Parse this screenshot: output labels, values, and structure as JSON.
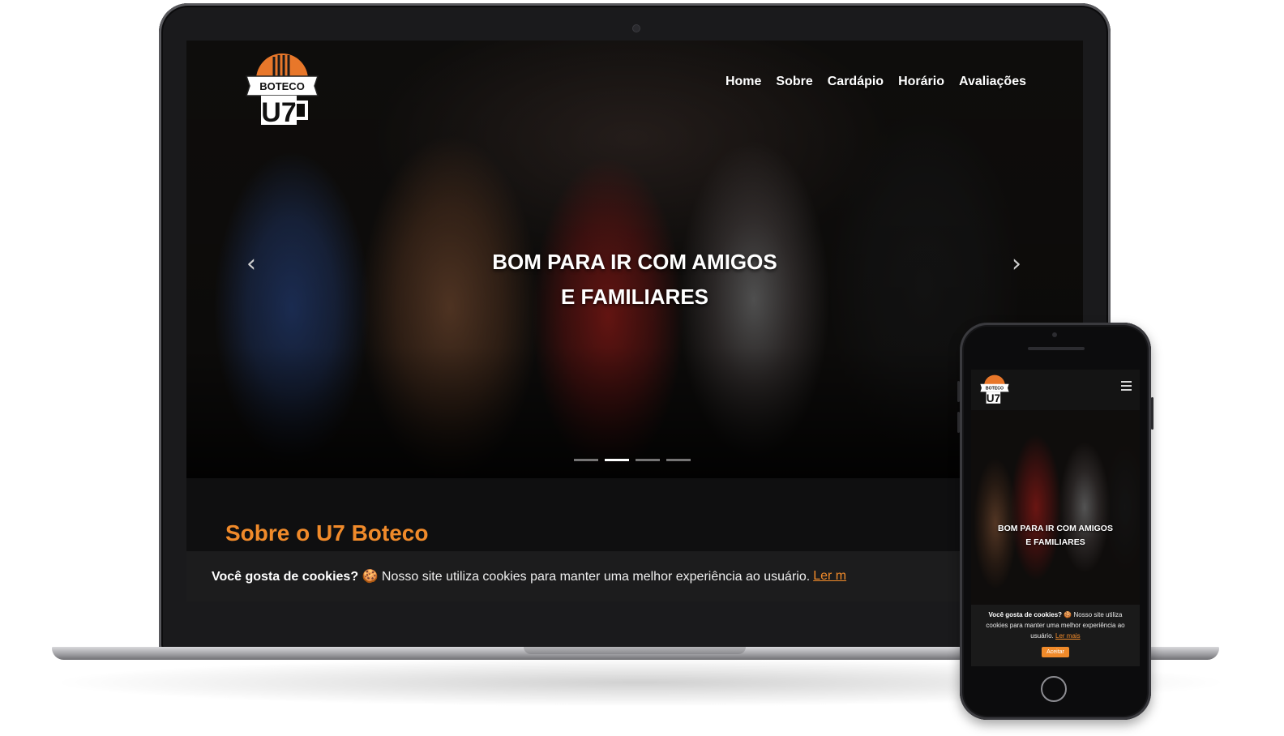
{
  "brand": {
    "logo_top": "BOTECO",
    "logo_main": "U7",
    "accent_color": "#f08a2a"
  },
  "desktop": {
    "nav": [
      {
        "label": "Home"
      },
      {
        "label": "Sobre"
      },
      {
        "label": "Cardápio"
      },
      {
        "label": "Horário"
      },
      {
        "label": "Avaliações"
      }
    ],
    "hero": {
      "title_line1": "BOM PARA IR COM AMIGOS",
      "title_line2": "E FAMILIARES",
      "prev_icon": "‹",
      "next_icon": "›",
      "slides": 4,
      "active_slide": 2
    },
    "about_title": "Sobre o U7 Boteco",
    "cookie": {
      "heading": "Você gosta de cookies?",
      "icon": "🍪",
      "text": "Nosso site utiliza cookies para manter uma melhor experiência ao usuário.",
      "link": "Ler m"
    }
  },
  "mobile": {
    "menu_icon": "hamburger-icon",
    "hero": {
      "title_line1": "BOM PARA IR COM AMIGOS",
      "title_line2": "E FAMILIARES"
    },
    "cookie": {
      "heading": "Você gosta de cookies?",
      "icon": "🍪",
      "text": "Nosso site utiliza cookies para manter uma melhor experiência ao usuário.",
      "link": "Ler mais",
      "accept": "Aceitar"
    }
  }
}
